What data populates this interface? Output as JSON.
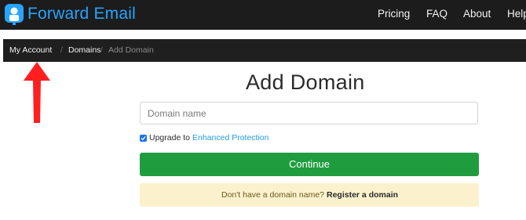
{
  "header": {
    "brand": "Forward Email",
    "nav": [
      "Pricing",
      "FAQ",
      "About",
      "Help"
    ]
  },
  "breadcrumb": {
    "items": [
      "My Account",
      "Domains",
      "Add Domain"
    ],
    "separator": "/"
  },
  "form": {
    "title": "Add Domain",
    "domain_placeholder": "Domain name",
    "domain_value": "",
    "upgrade_checked": true,
    "upgrade_label": "Upgrade to",
    "upgrade_link": "Enhanced Protection",
    "continue_label": "Continue"
  },
  "notice": {
    "text": "Don't have a domain name?",
    "link": "Register a domain"
  },
  "colors": {
    "navbar": "#1c1c1c",
    "brand": "#27a4ff",
    "continue": "#1f9c3e",
    "notice_bg": "#fbf2cd",
    "link": "#1f9be6",
    "annotation_arrow": "#ff1f1f"
  },
  "icons": {
    "logo": "forward-email-logo-icon",
    "annotation": "red-arrow-pointer-icon",
    "checkbox": "checkmark-icon"
  }
}
